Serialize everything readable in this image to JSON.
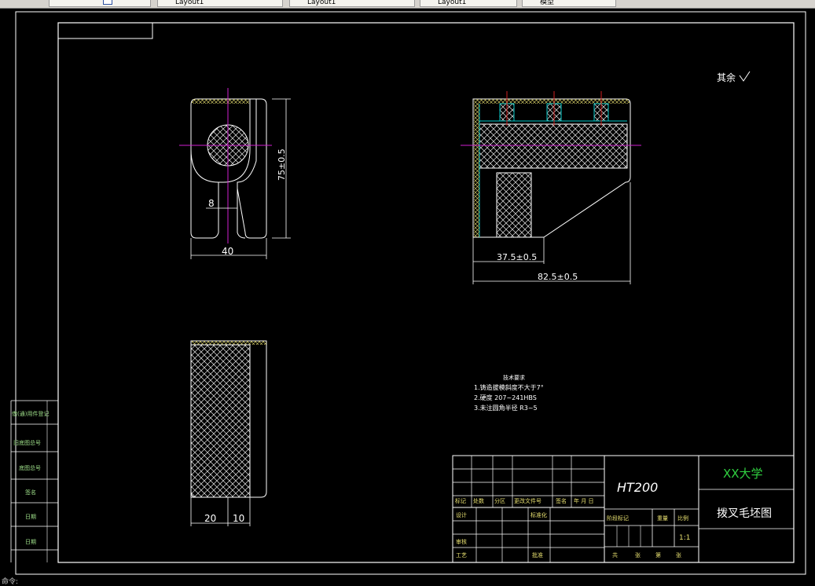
{
  "tabs": [
    {
      "label": ""
    },
    {
      "label": "Layout1"
    },
    {
      "label": "Layout1"
    },
    {
      "label": "Layout1"
    },
    {
      "label": "模型"
    }
  ],
  "drawing": {
    "front_view": {
      "hole_width": "8",
      "width": "40",
      "height": "75±0.5"
    },
    "side_view": {
      "length_short": "37.5±0.5",
      "length_long": "82.5±0.5"
    },
    "bottom_view": {
      "dim_a": "20",
      "dim_b": "10"
    },
    "surface_note": "其余",
    "tech_req": {
      "title": "技术要求",
      "line1": "1.铸造拔模斜度不大于7°",
      "line2": "2.硬度 207~241HBS",
      "line3": "3.未注圆角半径 R3~5"
    }
  },
  "title_block": {
    "material": "HT200",
    "school": "XX大学",
    "drawing_name": "拨叉毛坯图",
    "scale": "1:1",
    "row_labels": [
      "标记",
      "处数",
      "分区",
      "更改文件号",
      "签名",
      "年 月 日"
    ],
    "left_labels": [
      "设计",
      "审核",
      "工艺"
    ],
    "mid_labels": [
      "标准化",
      "",
      "批准"
    ],
    "stage_labels": [
      "阶段标记",
      "重量",
      "比例"
    ],
    "bottom_labels": [
      "共",
      "张",
      "第",
      "张"
    ]
  },
  "side_table": {
    "labels": [
      "借(通)用件登记",
      "旧底图总号",
      "底图总号",
      "签名",
      "日期",
      "日期"
    ]
  },
  "command_line": "命令:"
}
